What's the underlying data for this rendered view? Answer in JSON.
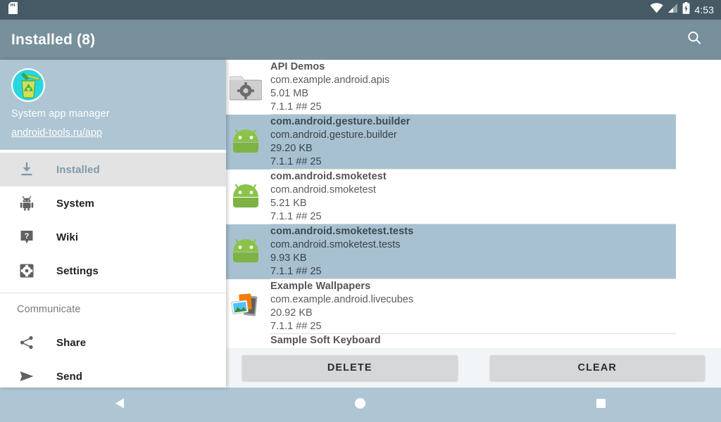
{
  "statusbar": {
    "sd_icon": "sd-card-icon",
    "wifi_icon": "wifi-icon",
    "signal_icon": "cell-signal-icon",
    "battery_icon": "battery-charging-icon",
    "time": "4:53"
  },
  "appbar": {
    "title": "Installed (8)",
    "search_icon": "search-icon"
  },
  "drawer": {
    "header": {
      "logo_icon": "recycle-bin-app-icon",
      "title": "System app manager",
      "link": "android-tools.ru/app"
    },
    "items": [
      {
        "label": "Installed",
        "icon": "download-icon",
        "selected": true
      },
      {
        "label": "System",
        "icon": "android-robot-icon",
        "selected": false
      },
      {
        "label": "Wiki",
        "icon": "help-question-icon",
        "selected": false
      },
      {
        "label": "Settings",
        "icon": "gear-icon",
        "selected": false
      }
    ],
    "section_label": "Communicate",
    "communicate_items": [
      {
        "label": "Share",
        "icon": "share-icon"
      },
      {
        "label": "Send",
        "icon": "send-paper-plane-icon"
      }
    ]
  },
  "app_list": [
    {
      "name": "API Demos",
      "package": "com.example.android.apis",
      "size": "5.01 MB",
      "version": "7.1.1 ## 25",
      "icon": "folder-gear-icon",
      "selected": false
    },
    {
      "name": "com.android.gesture.builder",
      "package": "com.android.gesture.builder",
      "size": "29.20 KB",
      "version": "7.1.1 ## 25",
      "icon": "android-robot-icon",
      "selected": true
    },
    {
      "name": "com.android.smoketest",
      "package": "com.android.smoketest",
      "size": "5.21 KB",
      "version": "7.1.1 ## 25",
      "icon": "android-robot-icon",
      "selected": false
    },
    {
      "name": "com.android.smoketest.tests",
      "package": "com.android.smoketest.tests",
      "size": "9.93 KB",
      "version": "7.1.1 ## 25",
      "icon": "android-robot-icon",
      "selected": true
    },
    {
      "name": "Example Wallpapers",
      "package": "com.example.android.livecubes",
      "size": "20.92 KB",
      "version": "7.1.1 ## 25",
      "icon": "wallpaper-photos-icon",
      "selected": false
    }
  ],
  "partial_row": {
    "name": "Sample Soft Keyboard"
  },
  "buttons": {
    "delete_label": "DELETE",
    "clear_label": "CLEAR"
  },
  "navbar": {
    "back_icon": "back-triangle-icon",
    "home_icon": "home-circle-icon",
    "recents_icon": "recents-square-icon"
  },
  "colors": {
    "appbar": "#78909c",
    "statusbar": "#455a64",
    "drawer_header": "#aec5d4",
    "row_selected": "#a8c1d1",
    "navbar": "#aec5d4",
    "button_face": "#d6d7d9"
  }
}
